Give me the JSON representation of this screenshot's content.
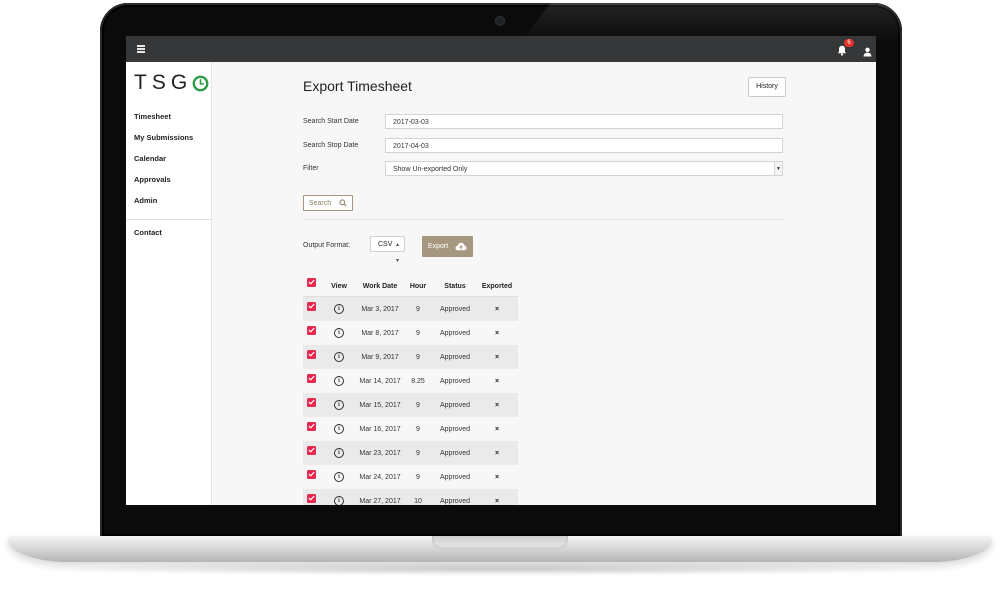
{
  "app": {
    "logo_text": "TSG",
    "notification_count": "6"
  },
  "sidebar": {
    "items": [
      {
        "label": "Timesheet"
      },
      {
        "label": "My Submissions"
      },
      {
        "label": "Calendar"
      },
      {
        "label": "Approvals"
      },
      {
        "label": "Admin"
      }
    ],
    "contact_label": "Contact"
  },
  "main": {
    "title": "Export Timesheet",
    "history_label": "History",
    "start_date_label": "Search Start Date",
    "start_date_value": "2017-03-03",
    "stop_date_label": "Search Stop Date",
    "stop_date_value": "2017-04-03",
    "filter_label": "Filter",
    "filter_value": "Show Un-exported Only",
    "search_label": "Search",
    "output_format_label": "Output Format:",
    "output_format_value": "CSV",
    "export_label": "Export"
  },
  "table": {
    "headers": {
      "view": "View",
      "work_date": "Work Date",
      "hour": "Hour",
      "status": "Status",
      "exported": "Exported"
    },
    "rows": [
      {
        "date": "Mar 3, 2017",
        "hour": "9",
        "status": "Approved"
      },
      {
        "date": "Mar 8, 2017",
        "hour": "9",
        "status": "Approved"
      },
      {
        "date": "Mar 9, 2017",
        "hour": "9",
        "status": "Approved"
      },
      {
        "date": "Mar 14, 2017",
        "hour": "8.25",
        "status": "Approved"
      },
      {
        "date": "Mar 15, 2017",
        "hour": "9",
        "status": "Approved"
      },
      {
        "date": "Mar 16, 2017",
        "hour": "9",
        "status": "Approved"
      },
      {
        "date": "Mar 23, 2017",
        "hour": "9",
        "status": "Approved"
      },
      {
        "date": "Mar 24, 2017",
        "hour": "9",
        "status": "Approved"
      },
      {
        "date": "Mar 27, 2017",
        "hour": "10",
        "status": "Approved"
      }
    ],
    "exported_mark": "×"
  },
  "colors": {
    "topbar": "#353739",
    "accent_brown": "#a69880",
    "checkbox_red": "#e5294e",
    "logo_green": "#2e9b47",
    "badge_red": "#e4322b"
  }
}
